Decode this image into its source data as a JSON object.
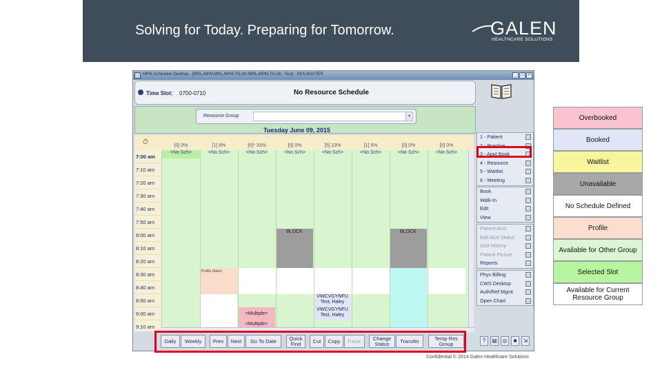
{
  "slide": {
    "tagline": "Solving for Today. Preparing for Tomorrow.",
    "logo_word": "GALEN",
    "logo_sub": "HEALTHCARE SOLUTIONS",
    "footer": "Confidential © 2014 Galen Healthcare Solutions"
  },
  "window": {
    "title": "MPM Scheduler Desktop - [MRL,MPM,MRL,MPM,TG,08 /MRL,MPM,TG,08 - Test) - KEN BAXTER"
  },
  "header": {
    "time_slot_label": "Time Slot:",
    "time_slot_value": "0700-0710",
    "schedule_title": "No Resource Schedule"
  },
  "resource_group": {
    "label": "Resource Group",
    "value": "",
    "date": "Tuesday  June 09, 2015"
  },
  "columns": [
    {
      "header": "[0] 0%",
      "sub": "<No Sch>"
    },
    {
      "header": "[1] 8%",
      "sub": "<No Sch>"
    },
    {
      "header": "[6]* 33%",
      "sub": "<No Sch>"
    },
    {
      "header": "[0] 0%",
      "sub": "<No Sch>"
    },
    {
      "header": "[5] 23%",
      "sub": "<No Sch>"
    },
    {
      "header": "[1] 5%",
      "sub": "<No Sch>"
    },
    {
      "header": "[0] 0%",
      "sub": "<No Sch>"
    },
    {
      "header": "[0] 0%",
      "sub": "<No Sch>"
    }
  ],
  "times": [
    "7:00 am",
    "7:10 am",
    "7:20 am",
    "7:30 am",
    "7:40 am",
    "7:50 am",
    "8:00 am",
    "8:10 am",
    "8:20 am",
    "8:30 am",
    "8:40 am",
    "8:50 am",
    "9:00 am",
    "9:10 am"
  ],
  "cells": {
    "block_1": "BLOCK",
    "block_2": "BLOCK",
    "profile_text": "Profile Status",
    "appt_1_line1": "VWCVGYNFU",
    "appt_1_line2": "Test, Haley",
    "appt_2_line1": "VWCVGYNFU",
    "appt_2_line2": "Test, Haley",
    "multiple_1": "<Multiple>",
    "multiple_2": "<Multiple>"
  },
  "menu": {
    "group1": [
      "1 - Patient",
      "2 - Practice",
      "3 - Appt Book",
      "4 - Resource",
      "5 - Waitlist",
      "6 - Meeting"
    ],
    "group2": [
      "Book",
      "Walk-In",
      "Edit",
      "View"
    ],
    "group3": [
      "Patient Acct",
      "Edit Acct Status",
      "Visit History",
      "Patient Picture",
      "Reports"
    ],
    "group4": [
      "Phys Billing",
      "CWS Desktop",
      "Auth/Ref Mgmt",
      "Open Chart"
    ]
  },
  "toolbar": {
    "daily": "Daily",
    "weekly": "Weekly",
    "prev": "Prev",
    "next": "Next",
    "go_to_date": "Go To Date",
    "quick_find": "Quick Find",
    "cut": "Cut",
    "copy": "Copy",
    "paste": "Paste",
    "change_status": "Change Status",
    "transfer": "Transfer",
    "temp_res_group": "Temp Res Group"
  },
  "legend": [
    {
      "label": "Overbooked",
      "color": "#f9c3cf"
    },
    {
      "label": "Booked",
      "color": "#e1e5f8"
    },
    {
      "label": "Waitlist",
      "color": "#f8f69c"
    },
    {
      "label": "Unavailable",
      "color": "#a8a8a8"
    },
    {
      "label": "No Schedule Defined",
      "color": "#ffffff"
    },
    {
      "label": "Profile",
      "color": "#fadfcf"
    },
    {
      "label": "Available for Other Group",
      "color": "#dbf6d2"
    },
    {
      "label": "Selected Slot",
      "color": "#b8f5a1"
    },
    {
      "label": "Available for Current Resource Group",
      "color": "#ffffff"
    }
  ],
  "colors": {
    "banner": "#3f4c5a",
    "highlight": "#e0001b"
  }
}
